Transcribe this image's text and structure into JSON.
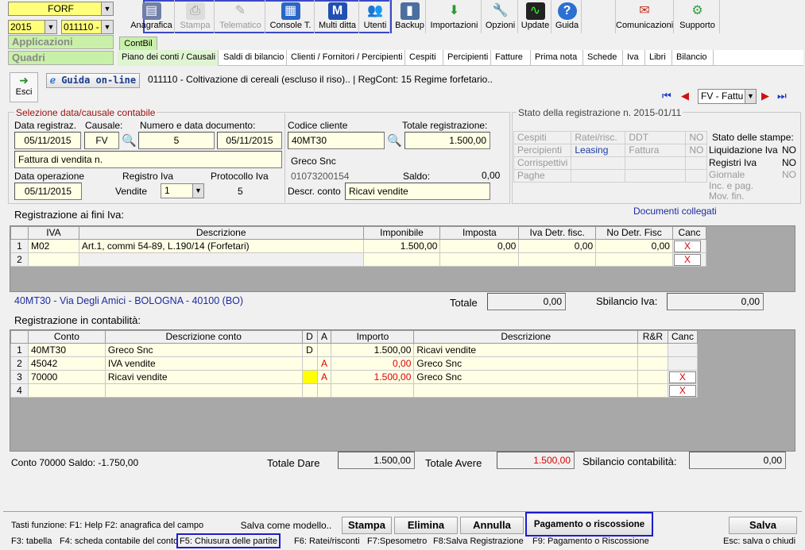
{
  "top_left": {
    "company": "FORF",
    "year": "2015",
    "company_code": "011110 -",
    "applicazioni": "Applicazioni",
    "quadri": "Quadri"
  },
  "toolbar": [
    {
      "label": "Anagrafica",
      "icon": "book-icon"
    },
    {
      "label": "Stampa",
      "icon": "printer-icon"
    },
    {
      "label": "Telematico",
      "icon": "telematico-icon"
    },
    {
      "label": "Console T.",
      "icon": "console-icon"
    },
    {
      "label": "Multi ditta",
      "icon": "multiditta-icon"
    },
    {
      "label": "Utenti",
      "icon": "users-icon"
    },
    {
      "label": "Backup",
      "icon": "backup-icon"
    },
    {
      "label": "Importazioni",
      "icon": "import-icon"
    },
    {
      "label": "Opzioni",
      "icon": "wrench-icon"
    },
    {
      "label": "Update",
      "icon": "update-icon"
    },
    {
      "label": "Guida",
      "icon": "help-icon"
    },
    {
      "label": "Comunicazioni",
      "icon": "comunicazioni-icon"
    },
    {
      "label": "Supporto",
      "icon": "supporto-icon"
    }
  ],
  "module_tab": "ContBil",
  "tabs": [
    "Piano dei conti / Causali",
    "Saldi di bilancio",
    "Clienti / Fornitori / Percipienti",
    "Cespiti",
    "Percipienti",
    "Fatture",
    "Prima nota",
    "Schede",
    "Iva",
    "Libri",
    "Bilancio"
  ],
  "header": {
    "exit": "Esci",
    "guide": "Guida on-line",
    "info": "011110 - Coltivazione di cereali (escluso il riso).. | RegCont: 15 Regime forfetario..",
    "causal_select": "FV - Fattu"
  },
  "selezione": {
    "legend": "Selezione data/causale contabile",
    "data_reg_label": "Data registraz.",
    "data_reg": "05/11/2015",
    "causale_label": "Causale:",
    "causale": "FV",
    "num_label": "Numero e data documento:",
    "numero": "5",
    "data_doc": "05/11/2015",
    "descr": "Fattura di vendita n.",
    "data_op_label": "Data operazione",
    "data_op": "05/11/2015",
    "reg_iva_label": "Registro Iva",
    "reg_iva_type": "Vendite",
    "reg_iva": "1",
    "prot_label": "Protocollo Iva",
    "prot": "5",
    "cod_cli_label": "Codice cliente",
    "cod_cli": "40MT30",
    "tot_label": "Totale registrazione:",
    "tot": "1.500,00",
    "cliente": "Greco Snc",
    "piva": "01073200154",
    "saldo_label": "Saldo:",
    "saldo": "0,00",
    "descr_conto_label": "Descr. conto",
    "descr_conto": "Ricavi vendite"
  },
  "stato": {
    "title": "Stato della registrazione n. 2015-01/11",
    "col1": [
      "Cespiti",
      "Percipienti",
      "Corrispettivi",
      "Paghe"
    ],
    "col2": [
      "Ratei/risc.",
      "Leasing",
      "",
      ""
    ],
    "col3": [
      "DDT",
      "Fattura",
      "",
      ""
    ],
    "col4": [
      "NO",
      "NO",
      "",
      ""
    ],
    "stampe_title": "Stato delle stampe:",
    "stampe": [
      {
        "l": "Liquidazione Iva",
        "v": "NO"
      },
      {
        "l": "Registri Iva",
        "v": "NO"
      },
      {
        "l": "Giornale",
        "v": "NO"
      },
      {
        "l": "Inc. e pag.",
        "v": ""
      },
      {
        "l": "Mov. fin.",
        "v": ""
      }
    ]
  },
  "iva": {
    "title": "Registrazione ai fini Iva:",
    "doc_link": "Documenti collegati",
    "headers": [
      "IVA",
      "Descrizione",
      "Imponibile",
      "Imposta",
      "Iva Detr. fisc.",
      "No Detr. Fisc",
      "Canc"
    ],
    "rows": [
      {
        "n": "1",
        "iva": "M02",
        "descr": "Art.1, commi 54-89, L.190/14 (Forfetari)",
        "imp": "1.500,00",
        "imposta": "0,00",
        "detr": "0,00",
        "nodetr": "0,00",
        "canc": "X"
      },
      {
        "n": "2",
        "iva": "",
        "descr": "",
        "imp": "",
        "imposta": "",
        "detr": "",
        "nodetr": "",
        "canc": "X"
      }
    ],
    "address": "40MT30 - Via Degli Amici - BOLOGNA - 40100 (BO)",
    "totale_label": "Totale",
    "totale": "0,00",
    "sbil_label": "Sbilancio Iva:",
    "sbil": "0,00"
  },
  "cont": {
    "title": "Registrazione in contabilità:",
    "headers": [
      "Conto",
      "Descrizione conto",
      "D",
      "A",
      "Importo",
      "Descrizione",
      "R&R",
      "Canc"
    ],
    "rows": [
      {
        "n": "1",
        "conto": "40MT30",
        "descr": "Greco Snc",
        "d": "D",
        "a": "",
        "imp": "1.500,00",
        "desc2": "Ricavi vendite",
        "canc": ""
      },
      {
        "n": "2",
        "conto": "45042",
        "descr": "IVA vendite",
        "d": "",
        "a": "A",
        "imp": "0,00",
        "desc2": "Greco Snc",
        "canc": ""
      },
      {
        "n": "3",
        "conto": "70000",
        "descr": "Ricavi vendite",
        "d": "",
        "a": "A",
        "imp": "1.500,00",
        "desc2": "Greco Snc",
        "canc": "X"
      },
      {
        "n": "4",
        "conto": "",
        "descr": "",
        "d": "",
        "a": "",
        "imp": "",
        "desc2": "",
        "canc": "X"
      }
    ],
    "saldo": "Conto 70000 Saldo: -1.750,00",
    "dare_label": "Totale Dare",
    "dare": "1.500,00",
    "avere_label": "Totale Avere",
    "avere": "1.500,00",
    "sbil_label": "Sbilancio contabilità:",
    "sbil": "0,00"
  },
  "bottom": {
    "fkeys_label": "Tasti funzione: F1: Help  F2: anagrafica del campo",
    "salva_modello": "Salva come modello..",
    "stampa": "Stampa",
    "elimina": "Elimina",
    "annulla": "Annulla",
    "pagamento": "Pagamento o riscossione",
    "salva": "Salva",
    "f3": "F3: tabella",
    "f4": "F4: scheda contabile del conto",
    "f5": "F5: Chiusura delle partite",
    "f6": "F6: Ratei/risconti",
    "f7": "F7:Spesometro",
    "f8": "F8:Salva Registrazione",
    "f9": "F9: Pagamento o Riscossione",
    "esc": "Esc: salva o chiudi"
  }
}
